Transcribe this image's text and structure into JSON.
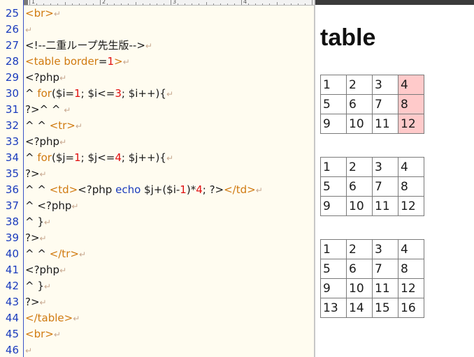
{
  "editor": {
    "ruler": {
      "labels": [
        "1",
        "2",
        "3",
        "4"
      ]
    },
    "lines": [
      {
        "no": "25",
        "segments": [
          {
            "t": "<br>",
            "c": "k-tag"
          }
        ]
      },
      {
        "no": "26",
        "segments": []
      },
      {
        "no": "27",
        "segments": [
          {
            "t": "<!--二重ループ先生版-->",
            "c": ""
          }
        ]
      },
      {
        "no": "28",
        "segments": [
          {
            "t": "<table ",
            "c": "k-tag"
          },
          {
            "t": "border",
            "c": "k-tag"
          },
          {
            "t": "=",
            "c": ""
          },
          {
            "t": "1",
            "c": "k-num"
          },
          {
            "t": ">",
            "c": "k-tag"
          }
        ]
      },
      {
        "no": "29",
        "segments": [
          {
            "t": "<?php",
            "c": ""
          }
        ]
      },
      {
        "no": "30",
        "segments": [
          {
            "t": "^ ",
            "c": "indent"
          },
          {
            "t": "for",
            "c": "k-kw"
          },
          {
            "t": "($i=",
            "c": ""
          },
          {
            "t": "1",
            "c": "k-num"
          },
          {
            "t": "; $i<=",
            "c": ""
          },
          {
            "t": "3",
            "c": "k-num"
          },
          {
            "t": "; $i++){",
            "c": ""
          }
        ]
      },
      {
        "no": "31",
        "segments": [
          {
            "t": "?>^ ^ ",
            "c": ""
          }
        ]
      },
      {
        "no": "32",
        "segments": [
          {
            "t": "^ ^ ",
            "c": "indent"
          },
          {
            "t": "<tr>",
            "c": "k-tag"
          }
        ]
      },
      {
        "no": "33",
        "segments": [
          {
            "t": "<?php",
            "c": ""
          }
        ]
      },
      {
        "no": "34",
        "segments": [
          {
            "t": "^ ",
            "c": "indent"
          },
          {
            "t": "for",
            "c": "k-kw"
          },
          {
            "t": "($j=",
            "c": ""
          },
          {
            "t": "1",
            "c": "k-num"
          },
          {
            "t": "; $j<=",
            "c": ""
          },
          {
            "t": "4",
            "c": "k-num"
          },
          {
            "t": "; $j++){",
            "c": ""
          }
        ]
      },
      {
        "no": "35",
        "segments": [
          {
            "t": "?>",
            "c": ""
          }
        ]
      },
      {
        "no": "36",
        "segments": [
          {
            "t": "^ ^ ",
            "c": "indent"
          },
          {
            "t": "<td>",
            "c": "k-tag"
          },
          {
            "t": "<?php ",
            "c": ""
          },
          {
            "t": "echo",
            "c": "k-blue"
          },
          {
            "t": " $j+($i-",
            "c": ""
          },
          {
            "t": "1",
            "c": "k-num"
          },
          {
            "t": ")*",
            "c": ""
          },
          {
            "t": "4",
            "c": "k-num"
          },
          {
            "t": "; ?>",
            "c": ""
          },
          {
            "t": "</td>",
            "c": "k-tag"
          }
        ]
      },
      {
        "no": "37",
        "segments": [
          {
            "t": "^ <?php",
            "c": ""
          }
        ]
      },
      {
        "no": "38",
        "segments": [
          {
            "t": "^ }",
            "c": ""
          }
        ]
      },
      {
        "no": "39",
        "segments": [
          {
            "t": "?>",
            "c": ""
          }
        ]
      },
      {
        "no": "40",
        "segments": [
          {
            "t": "^ ^ ",
            "c": "indent"
          },
          {
            "t": "</tr>",
            "c": "k-tag"
          }
        ]
      },
      {
        "no": "41",
        "segments": [
          {
            "t": "<?php",
            "c": ""
          }
        ]
      },
      {
        "no": "42",
        "segments": [
          {
            "t": "^ }",
            "c": ""
          }
        ]
      },
      {
        "no": "43",
        "segments": [
          {
            "t": "?>",
            "c": ""
          }
        ]
      },
      {
        "no": "44",
        "segments": [
          {
            "t": "</table>",
            "c": "k-tag"
          }
        ]
      },
      {
        "no": "45",
        "segments": [
          {
            "t": "<br>",
            "c": "k-tag"
          }
        ]
      },
      {
        "no": "46",
        "segments": []
      }
    ]
  },
  "preview": {
    "heading": "table",
    "tables": [
      {
        "rows": [
          [
            "1",
            "2",
            "3",
            "4"
          ],
          [
            "5",
            "6",
            "7",
            "8"
          ],
          [
            "9",
            "10",
            "11",
            "12"
          ]
        ],
        "highlight_col": 3
      },
      {
        "rows": [
          [
            "1",
            "2",
            "3",
            "4"
          ],
          [
            "5",
            "6",
            "7",
            "8"
          ],
          [
            "9",
            "10",
            "11",
            "12"
          ]
        ],
        "highlight_col": -1
      },
      {
        "rows": [
          [
            "1",
            "2",
            "3",
            "4"
          ],
          [
            "5",
            "6",
            "7",
            "8"
          ],
          [
            "9",
            "10",
            "11",
            "12"
          ],
          [
            "13",
            "14",
            "15",
            "16"
          ]
        ],
        "highlight_col": -1
      }
    ]
  },
  "colors": {
    "tag": "#d07a10",
    "number": "#e01010",
    "keyword_blue": "#1a3bbd",
    "line_number": "#1a3bbd",
    "editor_bg": "#fffcf0",
    "highlight_cell": "#ffcaca"
  }
}
